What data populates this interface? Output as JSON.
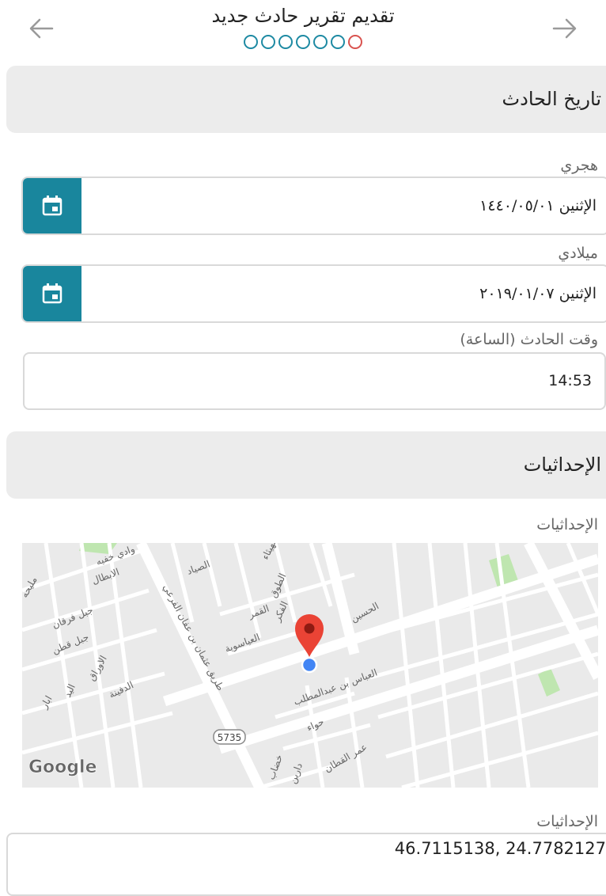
{
  "header": {
    "title": "تقديم تقرير حادث جديد",
    "steps_total": 7,
    "current_step": 7
  },
  "section_date": {
    "title": "تاريخ الحادث"
  },
  "hijri": {
    "label": "هجري",
    "value": "الإثنين  ١٤٤٠/٠٥/٠١"
  },
  "gregorian": {
    "label": "ميلادي",
    "value": "الإثنين  ٢٠١٩/٠١/٠٧"
  },
  "time": {
    "label": "وقت الحادث (الساعة)",
    "value": "14:53"
  },
  "section_coords": {
    "title": "الإحداثيات"
  },
  "map": {
    "label": "الإحداثيات",
    "attribution": "Google",
    "road_shield": "5735",
    "streets": [
      "وادي خفيه",
      "الابطال",
      "مليحه",
      "جبل فرقان",
      "جبل قطن",
      "الصياد",
      "الهيثاء",
      "الطوق",
      "الفكر",
      "القمر",
      "العياسوية",
      "الحسين",
      "طريق عثمان بن عفان الفرعي",
      "الاوراق",
      "الدفينة",
      "اليد",
      "ابار",
      "العباس بن عبدالمطلب",
      "حواء",
      "عمر القطان",
      "خضاب",
      "دارين"
    ],
    "colors": {
      "land": "#eaeaea",
      "road": "#ffffff",
      "park": "#bfe6b0",
      "pin": "#ea4335",
      "location": "#4285f4"
    }
  },
  "coords_field": {
    "label": "الإحداثيات",
    "value": "46.7115138, 24.7782127"
  },
  "icons": {
    "back": "arrow-left-icon",
    "forward": "arrow-right-icon",
    "calendar": "calendar-icon",
    "pin": "map-pin-icon"
  },
  "theme": {
    "accent": "#19869d",
    "step_active": "#d9534f"
  }
}
